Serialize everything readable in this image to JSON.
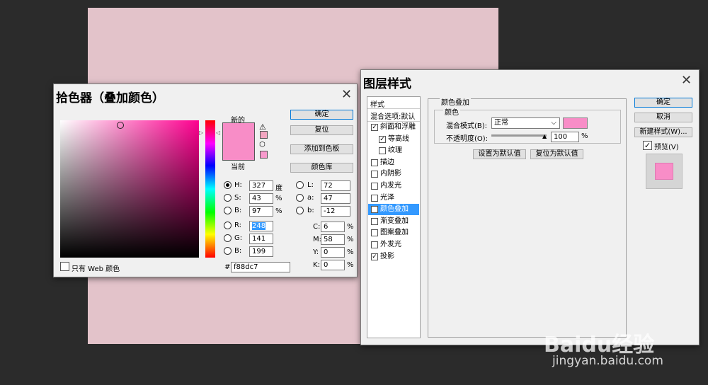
{
  "picker": {
    "title": "拾色器（叠加颜色）",
    "new_label": "新的",
    "current_label": "当前",
    "new_color": "#f88dc7",
    "current_color": "#f88dc7",
    "buttons": {
      "ok": "确定",
      "reset": "复位",
      "add_swatch": "添加到色板",
      "library": "颜色库"
    },
    "web_only": "只有 Web 颜色",
    "hex_prefix": "#",
    "hex": "f88dc7",
    "fields": {
      "H": {
        "label": "H:",
        "value": "327",
        "unit": "度"
      },
      "S": {
        "label": "S:",
        "value": "43",
        "unit": "%"
      },
      "B": {
        "label": "B:",
        "value": "97",
        "unit": "%"
      },
      "R": {
        "label": "R:",
        "value": "248"
      },
      "G": {
        "label": "G:",
        "value": "141"
      },
      "Bv": {
        "label": "B:",
        "value": "199"
      },
      "L": {
        "label": "L:",
        "value": "72"
      },
      "a": {
        "label": "a:",
        "value": "47"
      },
      "b": {
        "label": "b:",
        "value": "-12"
      },
      "C": {
        "label": "C:",
        "value": "6",
        "unit": "%"
      },
      "M": {
        "label": "M:",
        "value": "58",
        "unit": "%"
      },
      "Y": {
        "label": "Y:",
        "value": "0",
        "unit": "%"
      },
      "K": {
        "label": "K:",
        "value": "0",
        "unit": "%"
      }
    },
    "selected_radio": "H"
  },
  "layer_style": {
    "title": "图层样式",
    "styles_header": "样式",
    "blend_options": "混合选项:默认",
    "items": [
      {
        "label": "斜面和浮雕",
        "checked": true,
        "indent": false,
        "selected": false
      },
      {
        "label": "等高线",
        "checked": true,
        "indent": true,
        "selected": false
      },
      {
        "label": "纹理",
        "checked": false,
        "indent": true,
        "selected": false
      },
      {
        "label": "描边",
        "checked": false,
        "indent": false,
        "selected": false
      },
      {
        "label": "内阴影",
        "checked": false,
        "indent": false,
        "selected": false
      },
      {
        "label": "内发光",
        "checked": false,
        "indent": false,
        "selected": false
      },
      {
        "label": "光泽",
        "checked": false,
        "indent": false,
        "selected": false
      },
      {
        "label": "颜色叠加",
        "checked": true,
        "indent": false,
        "selected": true
      },
      {
        "label": "渐变叠加",
        "checked": false,
        "indent": false,
        "selected": false
      },
      {
        "label": "图案叠加",
        "checked": false,
        "indent": false,
        "selected": false
      },
      {
        "label": "外发光",
        "checked": false,
        "indent": false,
        "selected": false
      },
      {
        "label": "投影",
        "checked": true,
        "indent": false,
        "selected": false
      }
    ],
    "panel_title": "颜色叠加",
    "group_title": "颜色",
    "blend_mode_label": "混合模式(B):",
    "blend_mode_value": "正常",
    "opacity_label": "不透明度(O):",
    "opacity_value": "100",
    "opacity_unit": "%",
    "overlay_color": "#f88dc7",
    "set_default": "设置为默认值",
    "reset_default": "复位为默认值",
    "buttons": {
      "ok": "确定",
      "cancel": "取消",
      "new_style": "新建样式(W)..."
    },
    "preview_label": "预览(V)",
    "preview_checked": true
  },
  "watermark": {
    "brand": "Baidu经验",
    "url": "jingyan.baidu.com"
  }
}
